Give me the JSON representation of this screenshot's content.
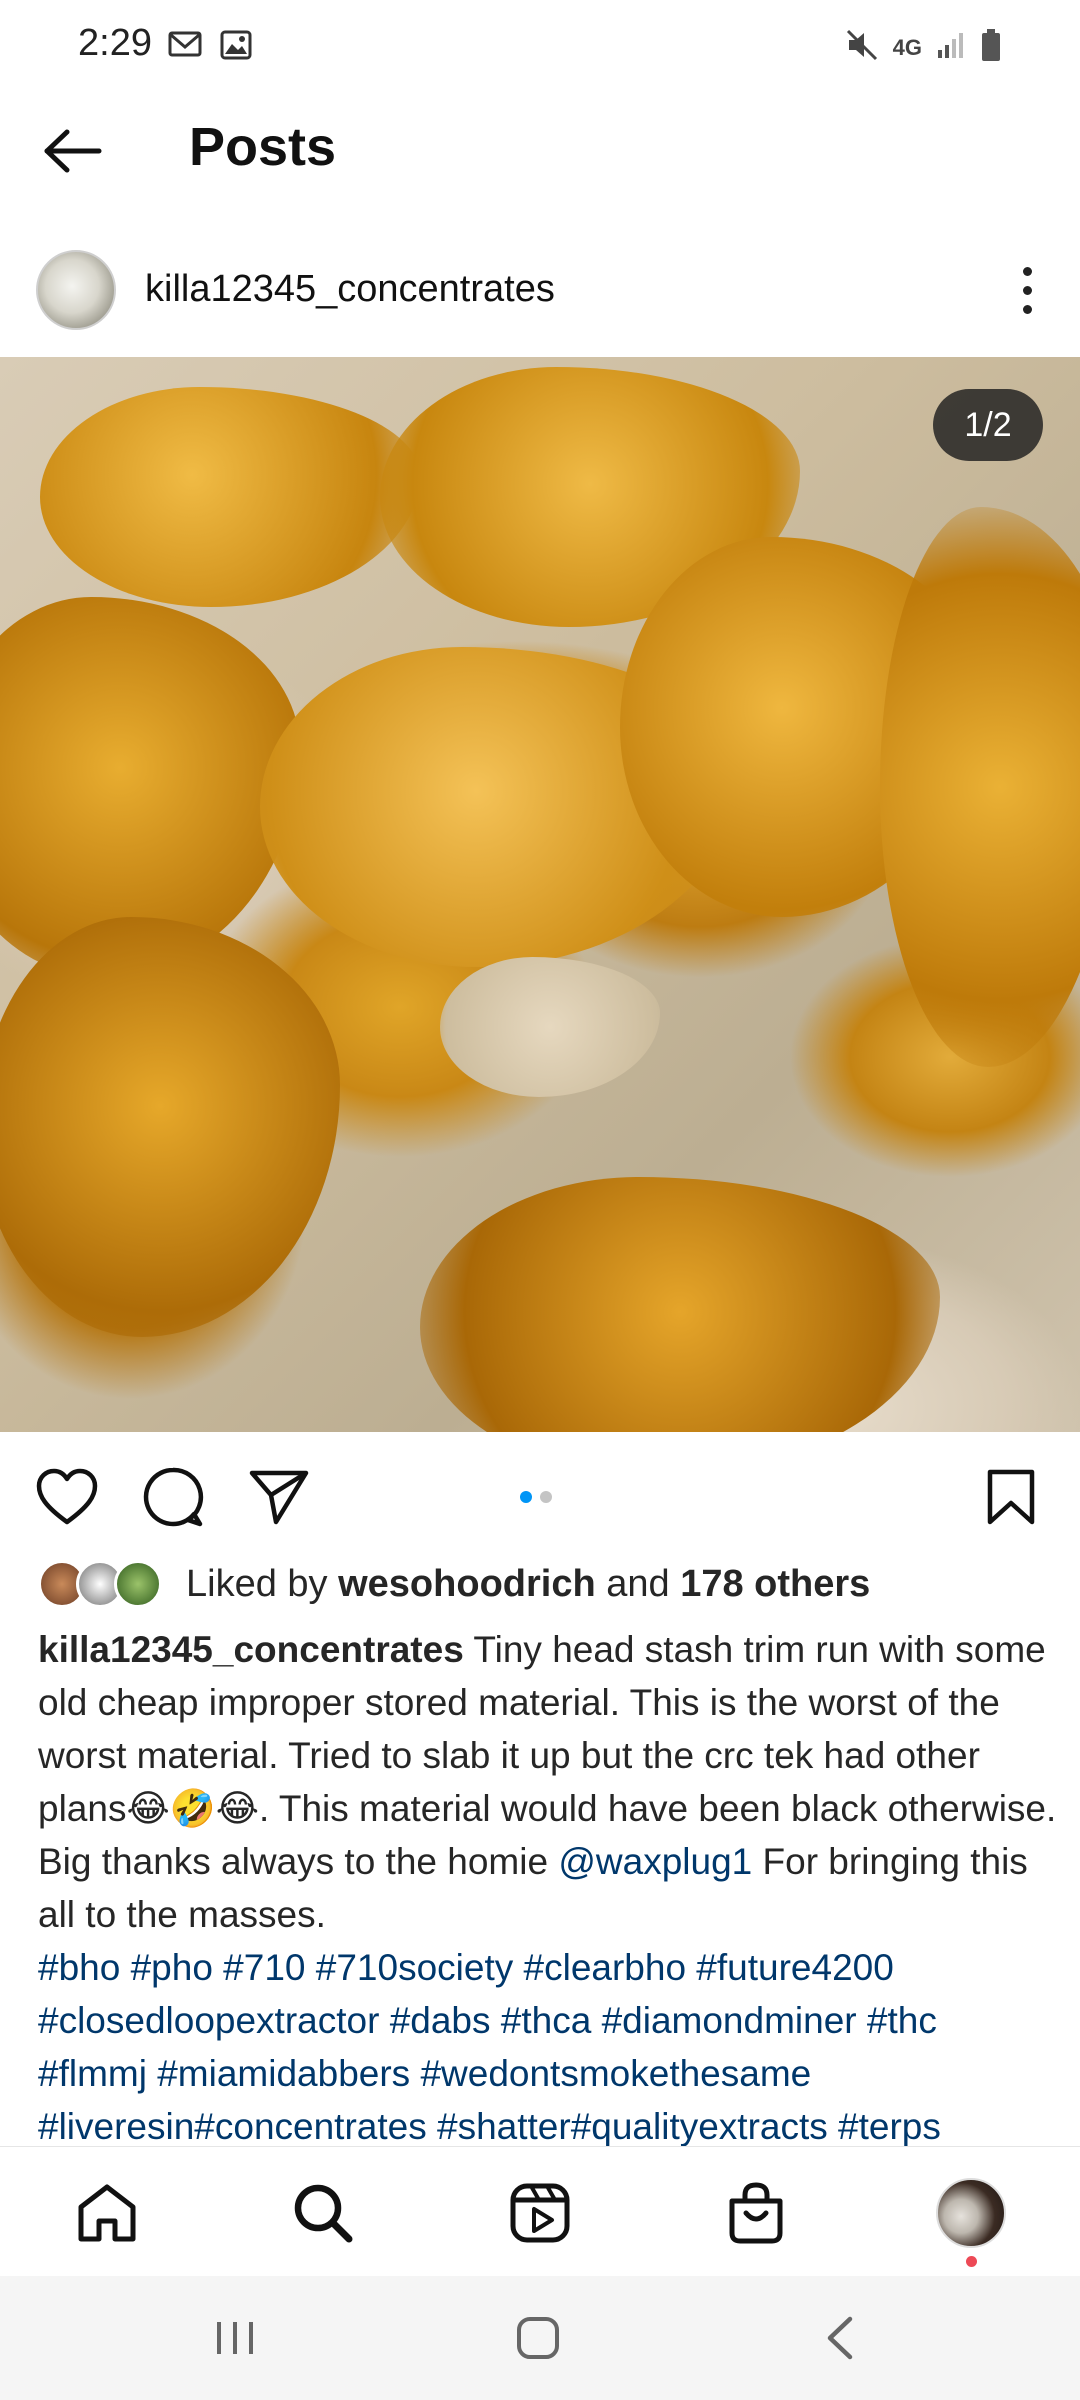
{
  "status_bar": {
    "time": "2:29",
    "left_icons": [
      "gmail-icon",
      "gallery-icon"
    ],
    "right_icons": [
      "mute-icon",
      "4g-icon",
      "signal-icon",
      "battery-icon"
    ],
    "network": "4G"
  },
  "header": {
    "title": "Posts",
    "back_icon": "back-arrow-icon"
  },
  "post": {
    "author": "killa12345_concentrates",
    "image_counter": "1/2",
    "carousel_dots": 2,
    "carousel_active": 1
  },
  "likes": {
    "prefix": "Liked by",
    "user": "wesohoodrich",
    "middle": "and",
    "others": "178 others"
  },
  "caption": {
    "author": "killa12345_concentrates",
    "text_1": " Tiny head stash trim run with some old cheap improper stored material.  This is the worst of the worst material.  Tried to slab it up but the crc tek had other plans😂🤣😂. This material would have been black otherwise. Big thanks always to the homie ",
    "mention": "@waxplug1",
    "text_2": " For bringing this all to the masses.",
    "hashtags_line_1": "#bho #pho #710  #710society #clearbho #future4200",
    "hashtags_line_2": "#closedloopextractor #dabs #thca #diamondminer #thc",
    "hashtags_line_3": "#flmmj #miamidabbers #wedontsmokethesame",
    "hashtags_line_4": "#liveresin#concentrates #shatter#qualityextracts #terps"
  },
  "bottom_nav": [
    "home-icon",
    "search-icon",
    "reels-icon",
    "shop-icon",
    "profile-avatar"
  ],
  "colors": {
    "link": "#00376b",
    "active_dot": "#0095f6",
    "notification": "#ed4956"
  }
}
